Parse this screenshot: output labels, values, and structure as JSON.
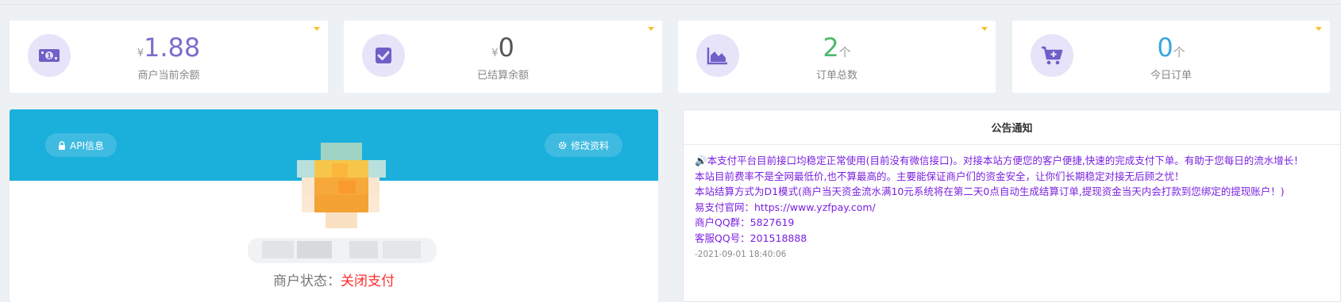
{
  "stats": [
    {
      "currency": "¥",
      "value": "1.88",
      "unit": "",
      "caption": "商户当前余额",
      "icon": "money-icon",
      "color": "#7b6fcb"
    },
    {
      "currency": "¥",
      "value": "0",
      "unit": "",
      "caption": "已结算余额",
      "icon": "check-square-icon",
      "color": "#555555"
    },
    {
      "currency": "",
      "value": "2",
      "unit": "个",
      "caption": "订单总数",
      "icon": "area-chart-icon",
      "color": "#4cb86a"
    },
    {
      "currency": "",
      "value": "0",
      "unit": "个",
      "caption": "今日订单",
      "icon": "cart-plus-icon",
      "color": "#3aa6e0"
    }
  ],
  "profile": {
    "api_button": "API信息",
    "edit_button": "修改资料",
    "status_label": "商户状态：",
    "status_value": "关闭支付"
  },
  "notice": {
    "title": "公告通知",
    "lines": [
      "🔊本支付平台目前接口均稳定正常使用(目前没有微信接口)。对接本站方便您的客户便捷,快速的完成支付下单。有助于您每日的流水增长！",
      "本站目前费率不是全网最低价,也不算最高的。主要能保证商户们的资金安全，让你们长期稳定对接无后顾之忧！",
      "本站结算方式为D1模式(商户当天资金流水满10元系统将在第二天0点自动生成结算订单,提现资金当天内会打款到您绑定的提现账户！)",
      "易支付官网：https://www.yzfpay.com/",
      "商户QQ群：5827619",
      "客服QQ号：201518888"
    ],
    "date": "-2021-09-01 18:40:06"
  },
  "colors": {
    "accent": "#1bafdc",
    "icon_bg": "#e7e3f8",
    "icon_fg": "#6f5fc7",
    "notice_text": "#7a1fe0",
    "status_closed": "#ff2d2d",
    "caret": "#f7c22e"
  }
}
